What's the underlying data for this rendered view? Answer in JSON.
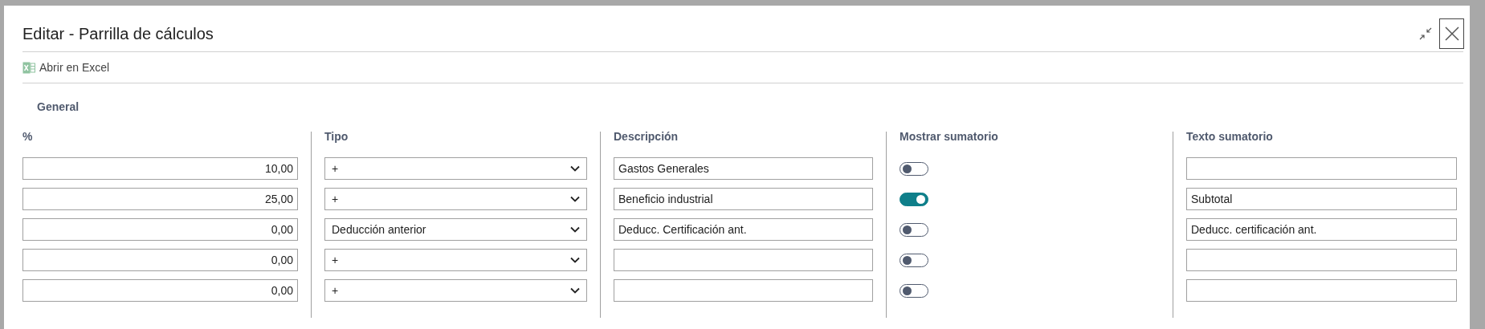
{
  "dialog": {
    "title": "Editar - Parrilla de cálculos"
  },
  "actions": [
    {
      "label": "Abrir en Excel"
    }
  ],
  "section": {
    "title": "General"
  },
  "columns": [
    "%",
    "Tipo",
    "Descripción",
    "Mostrar sumatorio",
    "Texto sumatorio"
  ],
  "rows": [
    {
      "percent": "10,00",
      "type": "+",
      "description": "Gastos Generales",
      "show_total": false,
      "total_text": ""
    },
    {
      "percent": "25,00",
      "type": "+",
      "description": "Beneficio industrial",
      "show_total": true,
      "total_text": "Subtotal"
    },
    {
      "percent": "0,00",
      "type": "Deducción anterior",
      "description": "Deducc. Certificación ant.",
      "show_total": false,
      "total_text": "Deducc. certificación ant."
    },
    {
      "percent": "0,00",
      "type": "+",
      "description": "",
      "show_total": false,
      "total_text": ""
    },
    {
      "percent": "0,00",
      "type": "+",
      "description": "",
      "show_total": false,
      "total_text": ""
    }
  ]
}
